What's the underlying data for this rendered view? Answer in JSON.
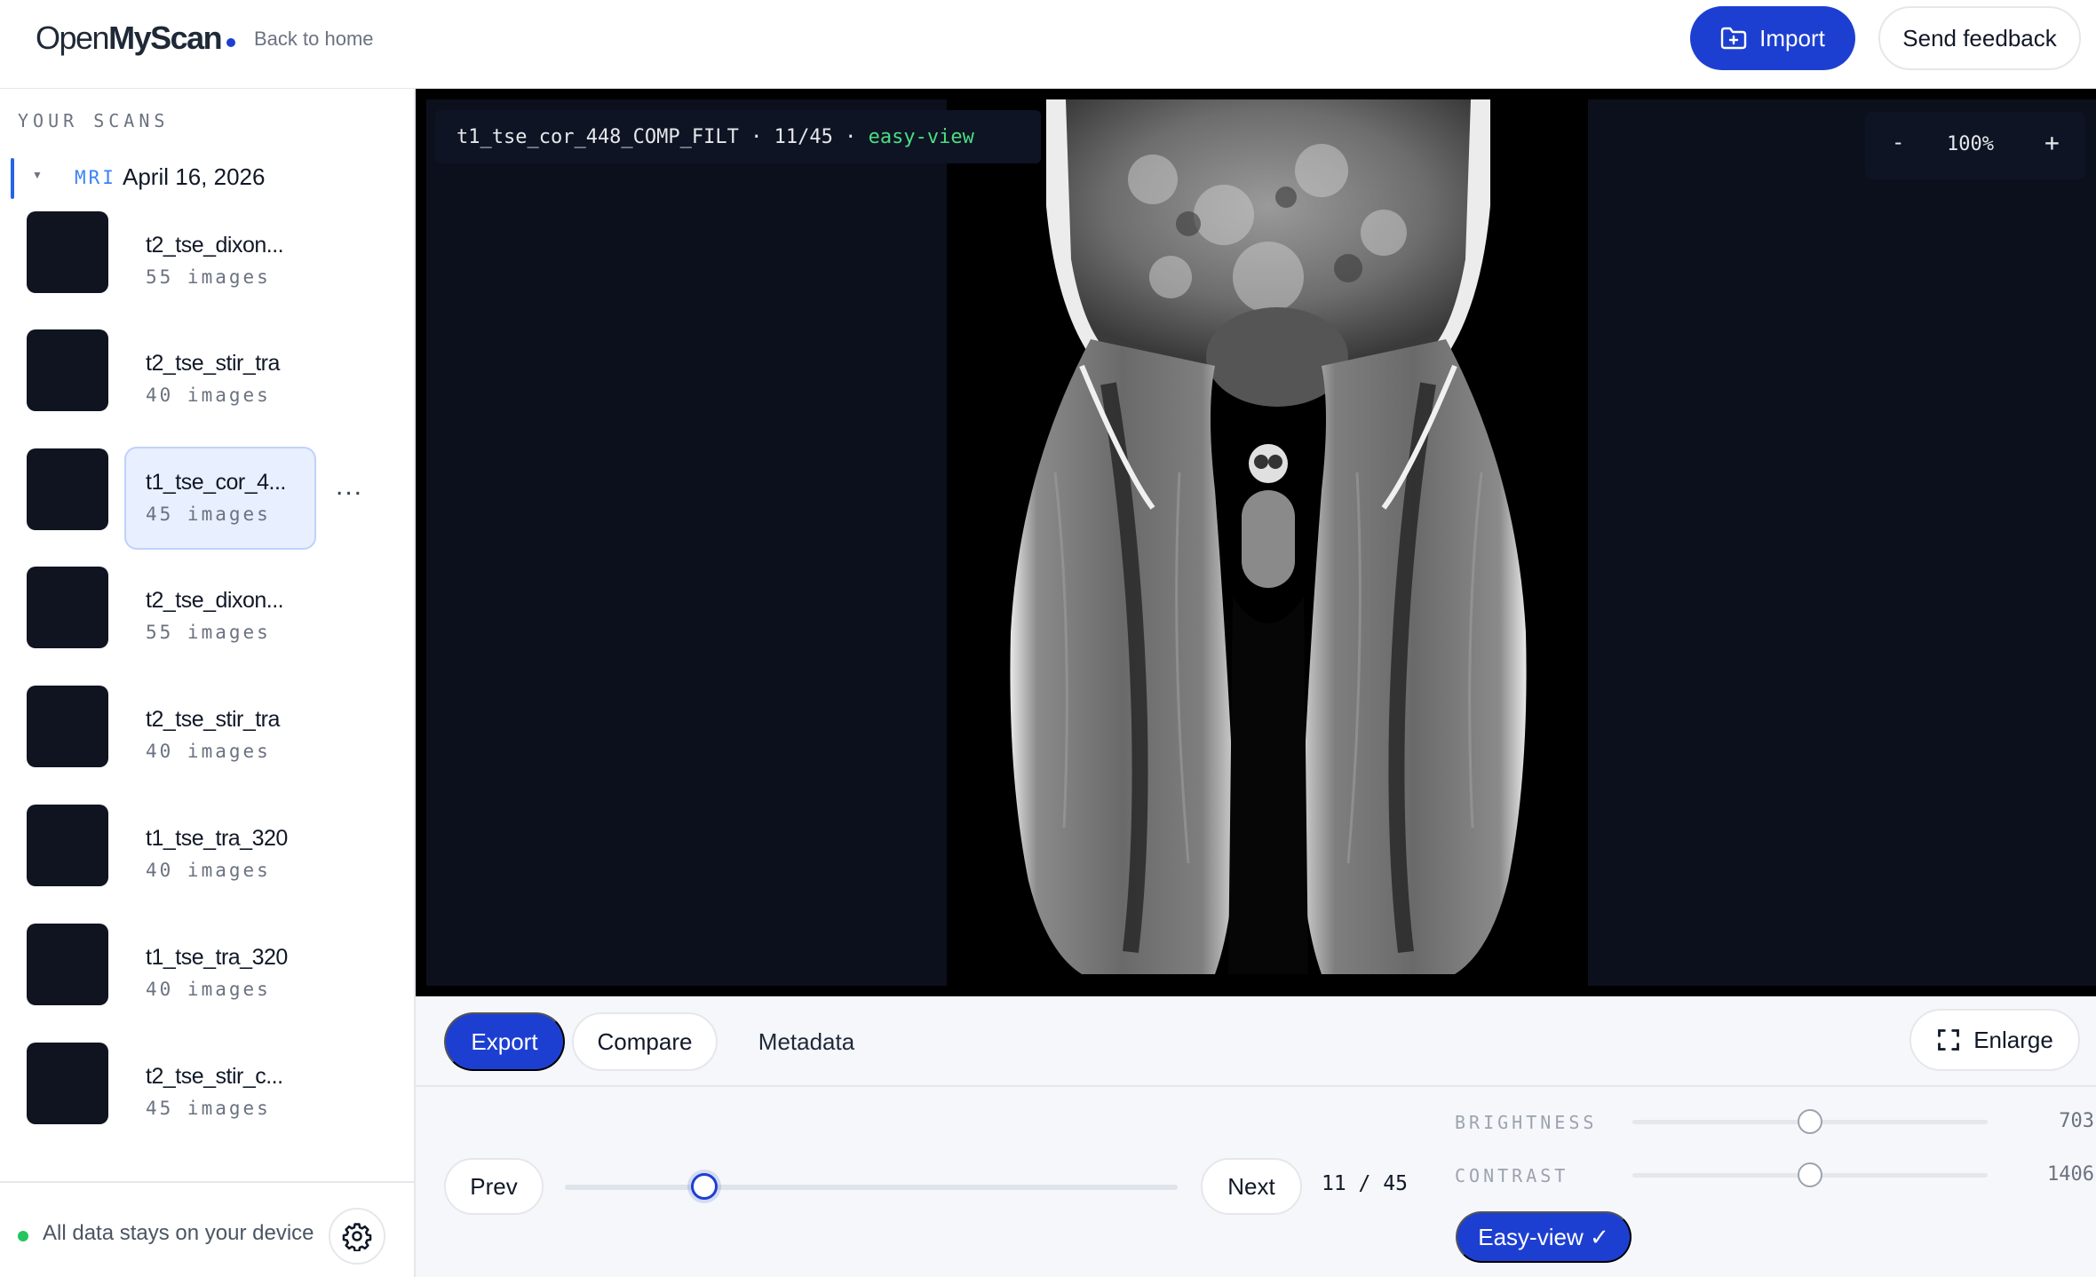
{
  "header": {
    "logo_light": "Open",
    "logo_bold": "MyScan",
    "back_link": "Back to home",
    "import_label": "Import",
    "feedback_label": "Send feedback"
  },
  "sidebar": {
    "section_title": "YOUR SCANS",
    "group": {
      "modality": "MRI",
      "date": "April 16, 2026"
    },
    "scans": [
      {
        "name": "t2_tse_dixon...",
        "count": "55 images"
      },
      {
        "name": "t2_tse_stir_tra",
        "count": "40 images"
      },
      {
        "name": "t1_tse_cor_4...",
        "count": "45 images",
        "active": true
      },
      {
        "name": "t2_tse_dixon...",
        "count": "55 images"
      },
      {
        "name": "t2_tse_stir_tra",
        "count": "40 images"
      },
      {
        "name": "t1_tse_tra_320",
        "count": "40 images"
      },
      {
        "name": "t1_tse_tra_320",
        "count": "40 images"
      },
      {
        "name": "t2_tse_stir_c...",
        "count": "45 images"
      }
    ],
    "more_label": "...",
    "footer_text": "All data stays on your device"
  },
  "viewer": {
    "series_name": "t1_tse_cor_448_COMP_FILT",
    "separator": " · ",
    "slice_label": "11/45",
    "mode_label": "easy-view",
    "zoom_minus": "-",
    "zoom_value": "100%",
    "zoom_plus": "+"
  },
  "tabs": {
    "export": "Export",
    "compare": "Compare",
    "metadata": "Metadata",
    "enlarge": "Enlarge"
  },
  "navigation": {
    "prev": "Prev",
    "next": "Next",
    "current": 11,
    "total": 45,
    "counter_text": "11 / 45"
  },
  "adjustments": {
    "brightness_label": "BRIGHTNESS",
    "brightness_value": "703",
    "brightness_level": 0.5,
    "contrast_label": "CONTRAST",
    "contrast_value": "1406",
    "contrast_level": 0.5,
    "easy_view_label": "Easy-view ✓"
  },
  "colors": {
    "accent": "#1d3fd1",
    "viewer_bg": "#0c101c",
    "mode_green": "#4ade80",
    "status_green": "#22c55e"
  }
}
